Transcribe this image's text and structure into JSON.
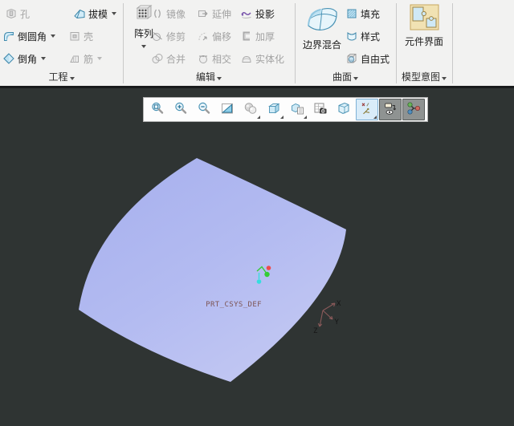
{
  "ribbon": {
    "groups": {
      "engineering": {
        "label": "工程",
        "hole": "孔",
        "draft": "拔模",
        "round": "倒圆角",
        "shell": "壳",
        "chamfer": "倒角",
        "rib": "筋"
      },
      "edit": {
        "label": "编辑",
        "pattern": "阵列",
        "mirror": "镜像",
        "extend": "延伸",
        "project": "投影",
        "trim": "修剪",
        "offset": "偏移",
        "thicken": "加厚",
        "merge": "合并",
        "intersect": "相交",
        "solidify": "实体化"
      },
      "surface": {
        "label": "曲面",
        "boundary_blend": "边界混合",
        "fill": "填充",
        "style": "样式",
        "freestyle": "自由式"
      },
      "model_intent": {
        "label": "模型意图",
        "component_interface": "元件界面"
      }
    }
  },
  "graphics_toolbar": {
    "icons": [
      "refit",
      "zoom-in",
      "zoom-out",
      "repaint",
      "shading-style",
      "display-style",
      "saved-views",
      "view-images",
      "perspective",
      "datum-display",
      "annotation-display",
      "spin-center"
    ],
    "datum_display_active": true,
    "annotation_display_pressed": true,
    "spin_center_pressed": true
  },
  "viewport": {
    "csys_label": "PRT_CSYS_DEF",
    "axes": {
      "x": "X",
      "y": "Y",
      "z": "Z"
    },
    "colors": {
      "background": "#2f3433",
      "surface_dark": "#a6afed",
      "surface_light": "#c3c8f3",
      "csys_line": "#8a5a5a",
      "csys_text": "#7d5555",
      "spin_red": "#ef4b4b",
      "spin_green": "#35cc35",
      "spin_cyan": "#35dede"
    }
  }
}
